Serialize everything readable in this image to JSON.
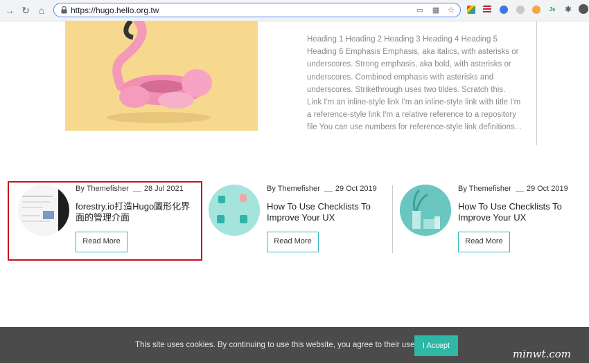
{
  "browser": {
    "url": "https://hugo.hello.org.tw",
    "nav_icons": [
      "back-arrow-icon",
      "reload-icon",
      "home-icon"
    ],
    "omnibox_icons": [
      "cast-icon",
      "qr-code-icon",
      "star-icon"
    ],
    "extension_icons": [
      "extension-colorful-icon",
      "flag-us-icon",
      "extension-shield-icon",
      "extension-moon-icon",
      "extension-emoji-icon",
      "extension-js-icon",
      "puzzle-icon",
      "profile-avatar"
    ]
  },
  "featured": {
    "excerpt": "Heading 1 Heading 2 Heading 3 Heading 4 Heading 5 Heading 6 Emphasis Emphasis, aka italics, with asterisks or underscores. Strong emphasis, aka bold, with asterisks or underscores. Combined emphasis with asterisks and underscores. Strikethrough uses two tildes. Scratch this. Link I'm an inline-style link I'm an inline-style link with title I'm a reference-style link I'm a relative reference to a repository file You can use numbers for reference-style link definitions..."
  },
  "cards": [
    {
      "author": "By Themefisher",
      "date": "28 Jul 2021",
      "title": "forestry.io打造Hugo圖形化界面的管理介面",
      "button": "Read More"
    },
    {
      "author": "By Themefisher",
      "date": "29 Oct 2019",
      "title": "How To Use Checklists To Improve Your UX",
      "button": "Read More"
    },
    {
      "author": "By Themefisher",
      "date": "29 Oct 2019",
      "title": "How To Use Checklists To Improve Your UX",
      "button": "Read More"
    }
  ],
  "cookie": {
    "text": "This site uses cookies. By continuing to use this website, you agree to their use.",
    "accept": "I Accept"
  },
  "watermark": "minwt.com",
  "colors": {
    "accent": "#30b6b8",
    "accept_button": "#2cb7a7",
    "highlight_border": "#c4141b",
    "cookie_bar": "#4b4b4b"
  }
}
